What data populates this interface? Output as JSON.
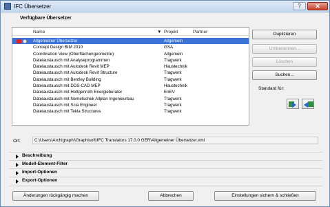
{
  "window": {
    "title": "IFC Übersetzer",
    "help": "?",
    "close": "✕"
  },
  "section": {
    "title": "Verfügbare Übersetzer"
  },
  "table": {
    "headers": {
      "name": "Name",
      "project": "Projekt",
      "partner": "Partner"
    },
    "rows": [
      {
        "name": "Allgemeiner Übersetzer",
        "project": "Allgemein",
        "selected": true
      },
      {
        "name": "Concept Design BIM 2010",
        "project": "GSA"
      },
      {
        "name": "Coordination View (Oberflächengeometrie)",
        "project": "Allgemein"
      },
      {
        "name": "Dateiaustausch mit Analyseprogrammen",
        "project": "Tragwerk"
      },
      {
        "name": "Dateiaustausch mit Autodesk Revit MEP",
        "project": "Haustechnik"
      },
      {
        "name": "Dateiaustausch mit Autodesk Revit Structure",
        "project": "Tragwerk"
      },
      {
        "name": "Dateiaustausch mit Bentley Building",
        "project": "Tragwerk"
      },
      {
        "name": "Dateiaustausch mit DDS-CAD MEP",
        "project": "Haustechnik"
      },
      {
        "name": "Dateiaustausch mit Hottgenroth Energieberater",
        "project": "EnEV"
      },
      {
        "name": "Dateiaustausch mit Nemetschek Allplan Ingenieurbau",
        "project": "Tragwerk"
      },
      {
        "name": "Dateiaustausch mit Scia Engineer",
        "project": "Tragwerk"
      },
      {
        "name": "Dateiaustausch mit Tekla Structures",
        "project": "Tragwerk"
      }
    ]
  },
  "side": {
    "duplicate": "Duplizieren",
    "rename": "Umbenennen...",
    "delete": "Löschen",
    "search": "Suchen...",
    "standard_label": "Standard für:"
  },
  "path": {
    "label": "Ort:",
    "value": "C:\\Users\\Archigraphi\\Graphisoft\\IFC Translators 17.0.0 GER\\Allgemeiner Übersetzer.xml"
  },
  "collapsibles": [
    "Beschreibung",
    "Modell-Element-Filter",
    "Import-Optionen",
    "Export-Optionen"
  ],
  "footer": {
    "undo": "Änderungen rückgängig machen",
    "cancel": "Abbrechen",
    "save_close": "Einstellungen sichern & schließen"
  },
  "colors": {
    "selection": "#3b74d6",
    "close": "#c4422c"
  }
}
